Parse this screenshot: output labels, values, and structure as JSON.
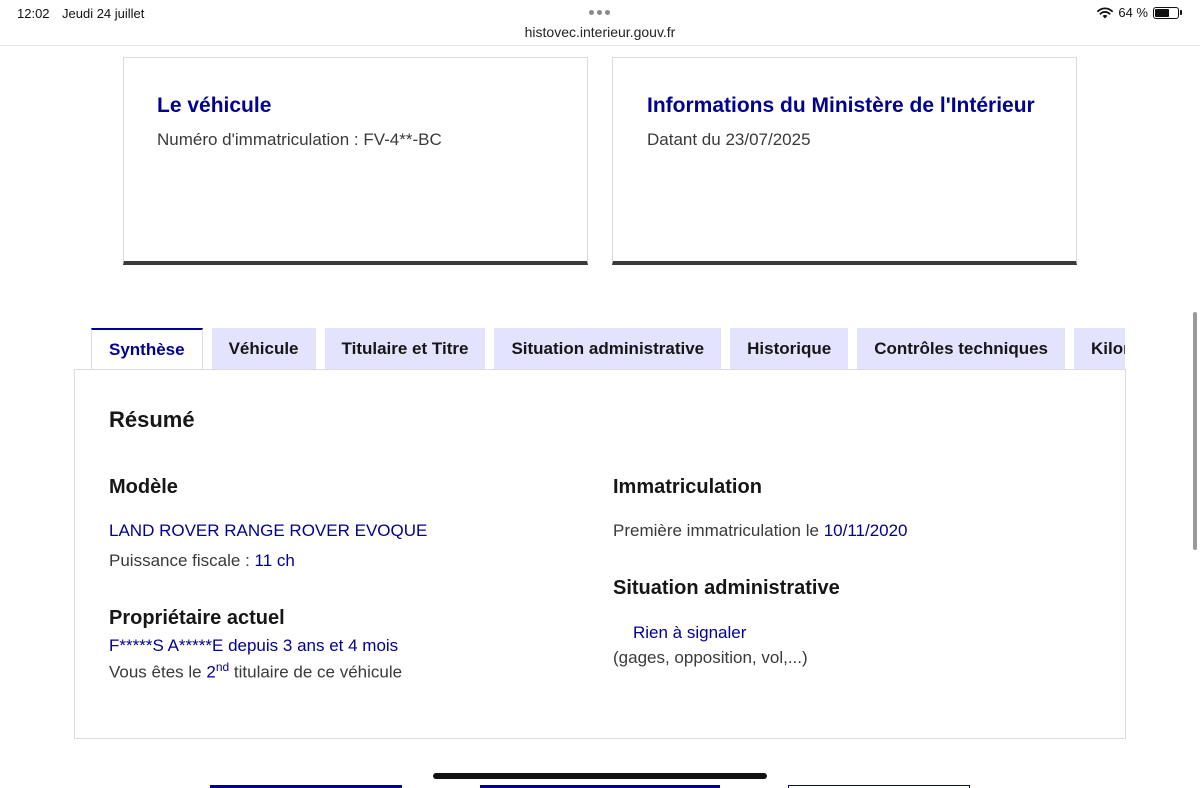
{
  "status_bar": {
    "time": "12:02",
    "date": "Jeudi 24 juillet",
    "url": "histovec.interieur.gouv.fr",
    "battery": "64 %"
  },
  "cards": [
    {
      "title": "Le véhicule",
      "text": "Numéro d'immatriculation : FV-4**-BC"
    },
    {
      "title": "Informations du Ministère de l'Intérieur",
      "text": "Datant du 23/07/2025"
    }
  ],
  "tabs": [
    "Synthèse",
    "Véhicule",
    "Titulaire et Titre",
    "Situation administrative",
    "Historique",
    "Contrôles techniques",
    "Kilométrage"
  ],
  "active_tab": "Synthèse",
  "summary": {
    "title": "Résumé",
    "model": {
      "heading": "Modèle",
      "name": "LAND ROVER RANGE ROVER EVOQUE",
      "power_label": "Puissance fiscale : ",
      "power_value": "11 ch"
    },
    "owner": {
      "heading": "Propriétaire actuel",
      "name": "F*****S A*****E",
      "since_label": " depuis ",
      "since_value": "3 ans et 4 mois",
      "holder_prefix": "Vous êtes le ",
      "holder_rank": "2",
      "holder_sup": "nd",
      "holder_suffix": " titulaire de ce véhicule"
    },
    "registration": {
      "heading": "Immatriculation",
      "label": "Première immatriculation le ",
      "date": "10/11/2020"
    },
    "admin": {
      "heading": "Situation administrative",
      "status": "Rien à signaler",
      "detail": "(gages, opposition, vol,...)"
    }
  },
  "colors": {
    "primary_blue": "#000091",
    "tab_background": "#e3e3fd",
    "text": "#3a3a3a"
  }
}
